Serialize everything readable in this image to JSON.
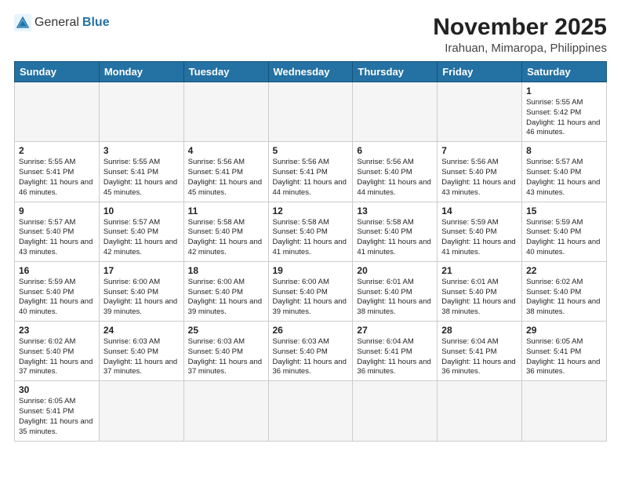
{
  "header": {
    "logo_general": "General",
    "logo_blue": "Blue",
    "month": "November 2025",
    "location": "Irahuan, Mimaropa, Philippines"
  },
  "weekdays": [
    "Sunday",
    "Monday",
    "Tuesday",
    "Wednesday",
    "Thursday",
    "Friday",
    "Saturday"
  ],
  "days": {
    "d1": {
      "num": "1",
      "sunrise": "5:55 AM",
      "sunset": "5:42 PM",
      "daylight": "11 hours and 46 minutes."
    },
    "d2": {
      "num": "2",
      "sunrise": "5:55 AM",
      "sunset": "5:41 PM",
      "daylight": "11 hours and 46 minutes."
    },
    "d3": {
      "num": "3",
      "sunrise": "5:55 AM",
      "sunset": "5:41 PM",
      "daylight": "11 hours and 45 minutes."
    },
    "d4": {
      "num": "4",
      "sunrise": "5:56 AM",
      "sunset": "5:41 PM",
      "daylight": "11 hours and 45 minutes."
    },
    "d5": {
      "num": "5",
      "sunrise": "5:56 AM",
      "sunset": "5:41 PM",
      "daylight": "11 hours and 44 minutes."
    },
    "d6": {
      "num": "6",
      "sunrise": "5:56 AM",
      "sunset": "5:40 PM",
      "daylight": "11 hours and 44 minutes."
    },
    "d7": {
      "num": "7",
      "sunrise": "5:56 AM",
      "sunset": "5:40 PM",
      "daylight": "11 hours and 43 minutes."
    },
    "d8": {
      "num": "8",
      "sunrise": "5:57 AM",
      "sunset": "5:40 PM",
      "daylight": "11 hours and 43 minutes."
    },
    "d9": {
      "num": "9",
      "sunrise": "5:57 AM",
      "sunset": "5:40 PM",
      "daylight": "11 hours and 43 minutes."
    },
    "d10": {
      "num": "10",
      "sunrise": "5:57 AM",
      "sunset": "5:40 PM",
      "daylight": "11 hours and 42 minutes."
    },
    "d11": {
      "num": "11",
      "sunrise": "5:58 AM",
      "sunset": "5:40 PM",
      "daylight": "11 hours and 42 minutes."
    },
    "d12": {
      "num": "12",
      "sunrise": "5:58 AM",
      "sunset": "5:40 PM",
      "daylight": "11 hours and 41 minutes."
    },
    "d13": {
      "num": "13",
      "sunrise": "5:58 AM",
      "sunset": "5:40 PM",
      "daylight": "11 hours and 41 minutes."
    },
    "d14": {
      "num": "14",
      "sunrise": "5:59 AM",
      "sunset": "5:40 PM",
      "daylight": "11 hours and 41 minutes."
    },
    "d15": {
      "num": "15",
      "sunrise": "5:59 AM",
      "sunset": "5:40 PM",
      "daylight": "11 hours and 40 minutes."
    },
    "d16": {
      "num": "16",
      "sunrise": "5:59 AM",
      "sunset": "5:40 PM",
      "daylight": "11 hours and 40 minutes."
    },
    "d17": {
      "num": "17",
      "sunrise": "6:00 AM",
      "sunset": "5:40 PM",
      "daylight": "11 hours and 39 minutes."
    },
    "d18": {
      "num": "18",
      "sunrise": "6:00 AM",
      "sunset": "5:40 PM",
      "daylight": "11 hours and 39 minutes."
    },
    "d19": {
      "num": "19",
      "sunrise": "6:00 AM",
      "sunset": "5:40 PM",
      "daylight": "11 hours and 39 minutes."
    },
    "d20": {
      "num": "20",
      "sunrise": "6:01 AM",
      "sunset": "5:40 PM",
      "daylight": "11 hours and 38 minutes."
    },
    "d21": {
      "num": "21",
      "sunrise": "6:01 AM",
      "sunset": "5:40 PM",
      "daylight": "11 hours and 38 minutes."
    },
    "d22": {
      "num": "22",
      "sunrise": "6:02 AM",
      "sunset": "5:40 PM",
      "daylight": "11 hours and 38 minutes."
    },
    "d23": {
      "num": "23",
      "sunrise": "6:02 AM",
      "sunset": "5:40 PM",
      "daylight": "11 hours and 37 minutes."
    },
    "d24": {
      "num": "24",
      "sunrise": "6:03 AM",
      "sunset": "5:40 PM",
      "daylight": "11 hours and 37 minutes."
    },
    "d25": {
      "num": "25",
      "sunrise": "6:03 AM",
      "sunset": "5:40 PM",
      "daylight": "11 hours and 37 minutes."
    },
    "d26": {
      "num": "26",
      "sunrise": "6:03 AM",
      "sunset": "5:40 PM",
      "daylight": "11 hours and 36 minutes."
    },
    "d27": {
      "num": "27",
      "sunrise": "6:04 AM",
      "sunset": "5:41 PM",
      "daylight": "11 hours and 36 minutes."
    },
    "d28": {
      "num": "28",
      "sunrise": "6:04 AM",
      "sunset": "5:41 PM",
      "daylight": "11 hours and 36 minutes."
    },
    "d29": {
      "num": "29",
      "sunrise": "6:05 AM",
      "sunset": "5:41 PM",
      "daylight": "11 hours and 36 minutes."
    },
    "d30": {
      "num": "30",
      "sunrise": "6:05 AM",
      "sunset": "5:41 PM",
      "daylight": "11 hours and 35 minutes."
    }
  }
}
